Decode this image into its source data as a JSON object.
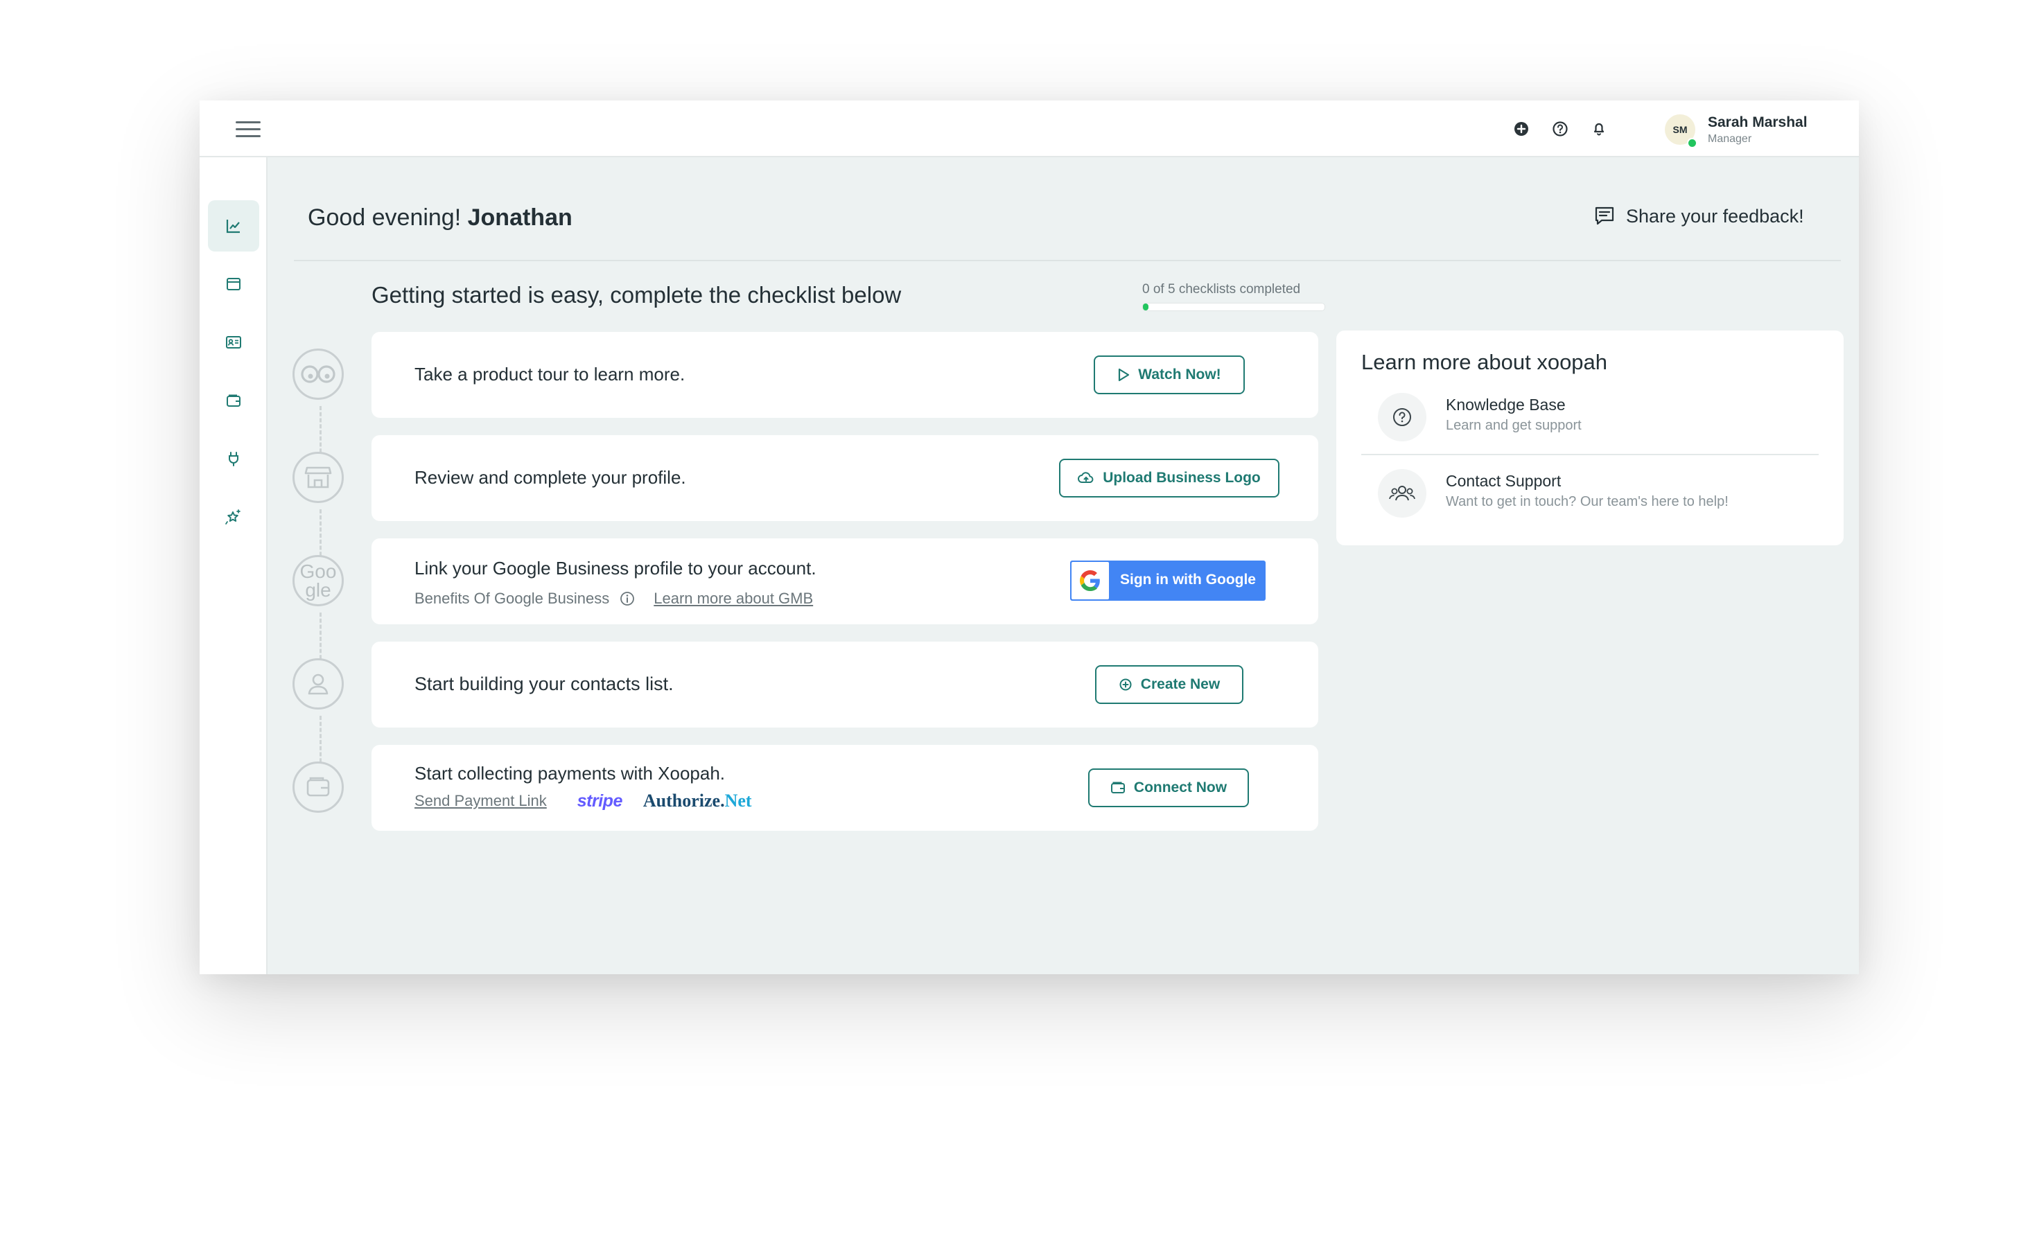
{
  "topbar": {
    "user": {
      "initials": "SM",
      "name": "Sarah Marshal",
      "role": "Manager"
    },
    "icons": [
      "add-circle-icon",
      "help-icon",
      "bell-icon"
    ]
  },
  "sidebar": {
    "items": [
      {
        "name": "analytics",
        "icon": "chart-icon",
        "active": true
      },
      {
        "name": "browser",
        "icon": "browser-window-icon",
        "active": false
      },
      {
        "name": "contacts",
        "icon": "contact-card-icon",
        "active": false
      },
      {
        "name": "payments",
        "icon": "wallet-icon",
        "active": false
      },
      {
        "name": "integrations",
        "icon": "plug-icon",
        "active": false
      },
      {
        "name": "reviews",
        "icon": "star-sparkle-icon",
        "active": false
      }
    ]
  },
  "header": {
    "greeting": "Good evening!",
    "user_first_name": "Jonathan",
    "feedback_label": "Share your feedback!"
  },
  "checklist": {
    "title": "Getting started is easy, complete the checklist below",
    "progress_text": "0 of 5 checklists completed",
    "progress_fraction": 0,
    "items": [
      {
        "title": "Take a product tour to learn more.",
        "button": "Watch Now!",
        "icon": "eyes-icon"
      },
      {
        "title": "Review and complete your profile.",
        "button": "Upload Business Logo",
        "icon": "store-icon"
      },
      {
        "title": "Link your Google Business profile to your account.",
        "subtitle": "Benefits Of Google Business",
        "link": "Learn more about GMB",
        "button": "Sign in with Google",
        "icon_alt": "Google"
      },
      {
        "title": "Start building your contacts list.",
        "button": "Create New",
        "icon": "user-icon"
      },
      {
        "title": "Start collecting payments with Xoopah.",
        "link": "Send Payment Link",
        "providers": {
          "stripe": "stripe",
          "authnet_main": "Authorize.",
          "authnet_suffix": "Net"
        },
        "button": "Connect Now",
        "icon": "wallet-icon"
      }
    ]
  },
  "learn_more": {
    "title": "Learn more about xoopah",
    "items": [
      {
        "name": "Knowledge Base",
        "desc": "Learn and get support",
        "icon": "question-circle-icon"
      },
      {
        "name": "Contact Support",
        "desc": "Want to get in touch? Our team's here to help!",
        "icon": "team-icon"
      }
    ]
  },
  "colors": {
    "accent": "#1f7a72",
    "google_blue": "#4285f4",
    "background": "#edf2f2",
    "progress": "#22c55e"
  }
}
